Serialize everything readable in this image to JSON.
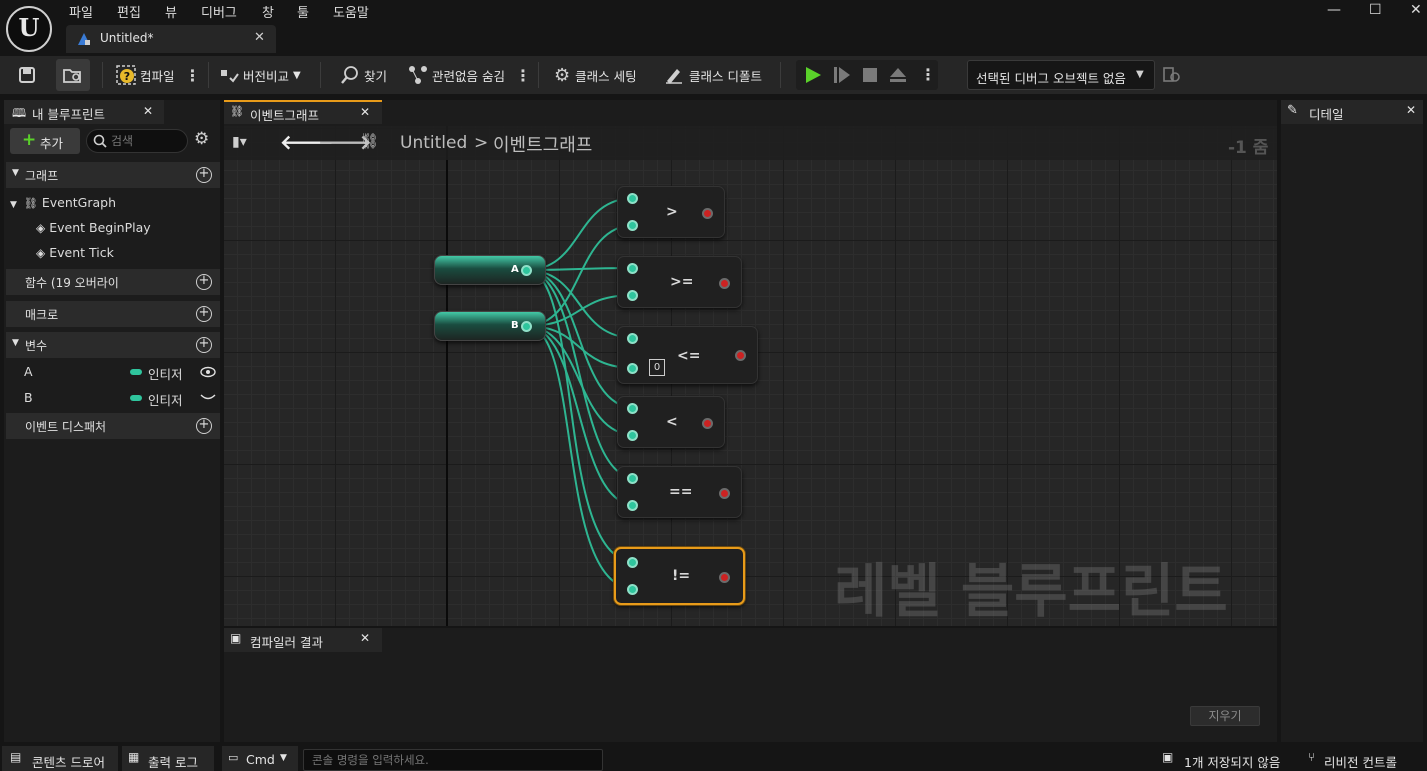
{
  "menu": [
    "파일",
    "편집",
    "뷰",
    "디버그",
    "창",
    "툴",
    "도움말"
  ],
  "doc_tab": {
    "title": "Untitled*"
  },
  "toolbar": {
    "compile": "컴파일",
    "diff": "버전비교",
    "find": "찾기",
    "hide_unrelated": "관련없음 숨김",
    "class_settings": "클래스 세팅",
    "class_defaults": "클래스 디폴트",
    "debug_object": "선택된 디버그 오브젝트 없음"
  },
  "my_blueprint": {
    "tab": "내 블루프린트",
    "add": "추가",
    "search_placeholder": "검색",
    "graphs_header": "그래프",
    "event_graph": "EventGraph",
    "events": [
      "Event BeginPlay",
      "Event Tick"
    ],
    "functions_header": "함수 (19 오버라이",
    "macros_header": "매크로",
    "variables_header": "변수",
    "variables": [
      {
        "name": "A",
        "type": "인티저"
      },
      {
        "name": "B",
        "type": "인티저"
      }
    ],
    "dispatchers_header": "이벤트 디스패처"
  },
  "graph_tab": {
    "label": "이벤트그래프"
  },
  "breadcrumb": {
    "root": "Untitled",
    "sep": ">",
    "current": "이벤트그래프",
    "zoom": "-1 줌"
  },
  "graph": {
    "watermark": "레벨 블루프린트",
    "variables": [
      "A",
      "B"
    ],
    "operators": [
      ">",
      ">=",
      "<=",
      "<",
      "==",
      "!="
    ],
    "default_value": "0"
  },
  "details": {
    "tab": "디테일"
  },
  "compiler": {
    "tab": "컴파일러 결과",
    "clear": "지우기"
  },
  "statusbar": {
    "content_drawer": "콘텐츠 드로어",
    "output_log": "출력 로그",
    "cmd": "Cmd",
    "console_placeholder": "콘솔 명령을 입력하세요.",
    "unsaved": "1개 저장되지 않음",
    "revision": "리비전 컨트롤"
  },
  "colors": {
    "int_pin": "#2fc59d",
    "accent": "#e89b1a",
    "play": "#5ad12a"
  }
}
